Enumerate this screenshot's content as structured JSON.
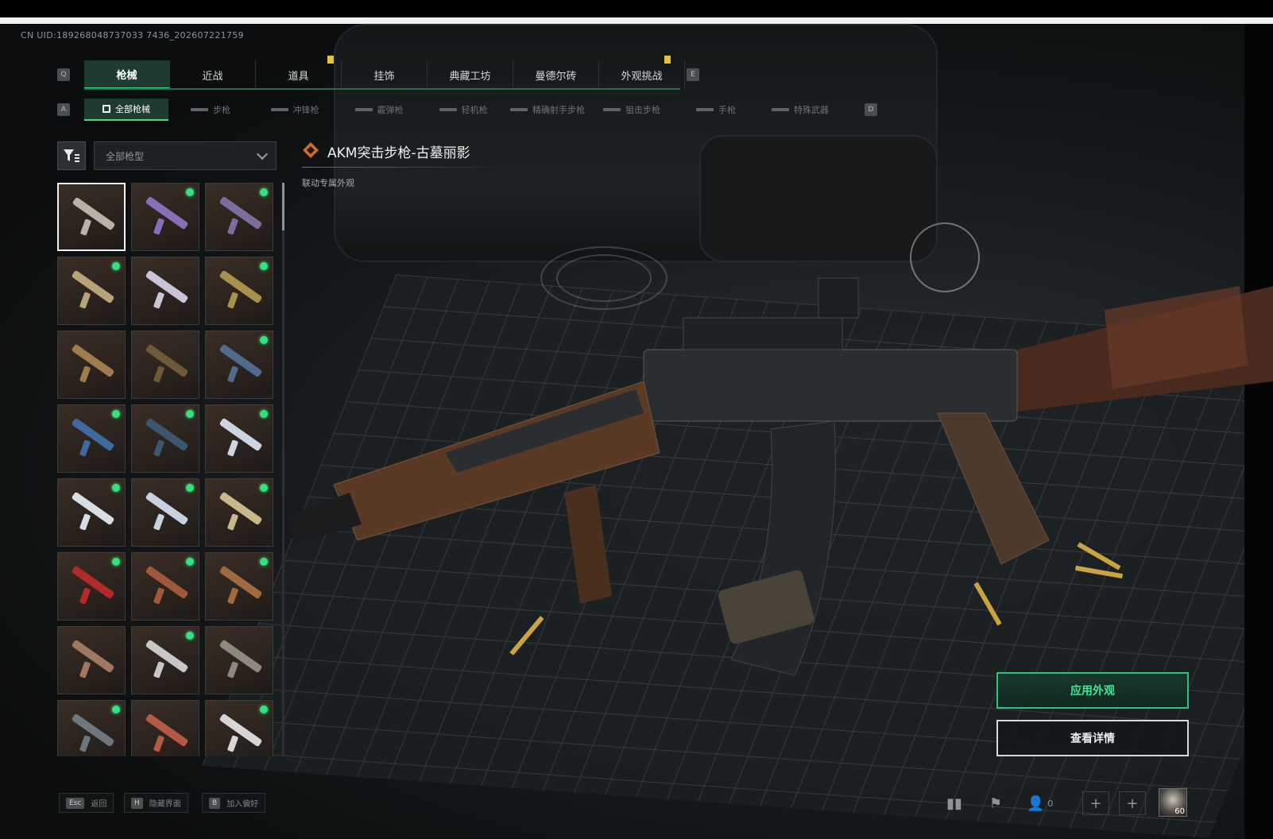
{
  "uid": "CN UID:189268048737033 7436_202607221759",
  "main_tabs": [
    {
      "label": "枪械",
      "active": true
    },
    {
      "label": "近战",
      "active": false
    },
    {
      "label": "道具",
      "active": false
    },
    {
      "label": "挂饰",
      "active": false
    },
    {
      "label": "典藏工坊",
      "active": false
    },
    {
      "label": "曼德尔砖",
      "active": false
    },
    {
      "label": "外观挑战",
      "active": false
    }
  ],
  "tab_keys": {
    "left": "Q",
    "right": "E"
  },
  "sub_tabs": [
    {
      "label": "全部枪械",
      "active": true
    },
    {
      "label": "步枪",
      "active": false
    },
    {
      "label": "冲锋枪",
      "active": false
    },
    {
      "label": "霰弹枪",
      "active": false
    },
    {
      "label": "轻机枪",
      "active": false
    },
    {
      "label": "精确射手步枪",
      "active": false
    },
    {
      "label": "狙击步枪",
      "active": false
    },
    {
      "label": "手枪",
      "active": false
    },
    {
      "label": "特殊武器",
      "active": false
    }
  ],
  "sub_tab_keys": {
    "left": "A",
    "right": "D"
  },
  "filter": {
    "selected": "全部枪型"
  },
  "item": {
    "title": "AKM突击步枪-古墓丽影",
    "subtitle": "联动专属外观"
  },
  "grid": [
    {
      "color": "#b9b2a6",
      "new": false,
      "selected": true
    },
    {
      "color": "#8a6fb8",
      "new": true
    },
    {
      "color": "#7a6e9a",
      "new": true
    },
    {
      "color": "#b9a27a",
      "new": true
    },
    {
      "color": "#c9c4d8",
      "new": false
    },
    {
      "color": "#a8904e",
      "new": true
    },
    {
      "color": "#9e7c4e",
      "new": false
    },
    {
      "color": "#6e5a3a",
      "new": false
    },
    {
      "color": "#4e6a8c",
      "new": true
    },
    {
      "color": "#3e6a9e",
      "new": true
    },
    {
      "color": "#3d5670",
      "new": true
    },
    {
      "color": "#cdd5e0",
      "new": true
    },
    {
      "color": "#d8dee6",
      "new": true
    },
    {
      "color": "#c6d2de",
      "new": true
    },
    {
      "color": "#c9b98a",
      "new": true
    },
    {
      "color": "#b32a2a",
      "new": true
    },
    {
      "color": "#a0583a",
      "new": true
    },
    {
      "color": "#a06a40",
      "new": true
    },
    {
      "color": "#a0785e",
      "new": false
    },
    {
      "color": "#c7c7c7",
      "new": true
    },
    {
      "color": "#8c8a7e",
      "new": false
    },
    {
      "color": "#6e7680",
      "new": true
    },
    {
      "color": "#b25a44",
      "new": false
    },
    {
      "color": "#d6d6d6",
      "new": true
    }
  ],
  "buttons": {
    "apply": "应用外观",
    "details": "查看详情"
  },
  "hotkeys": [
    {
      "key": "Esc",
      "label": "返回"
    },
    {
      "key": "H",
      "label": "隐藏界面"
    },
    {
      "key": "B",
      "label": "加入偏好"
    }
  ],
  "friends_count": "0",
  "avatar_level": "60",
  "accent": "#2fe38a"
}
